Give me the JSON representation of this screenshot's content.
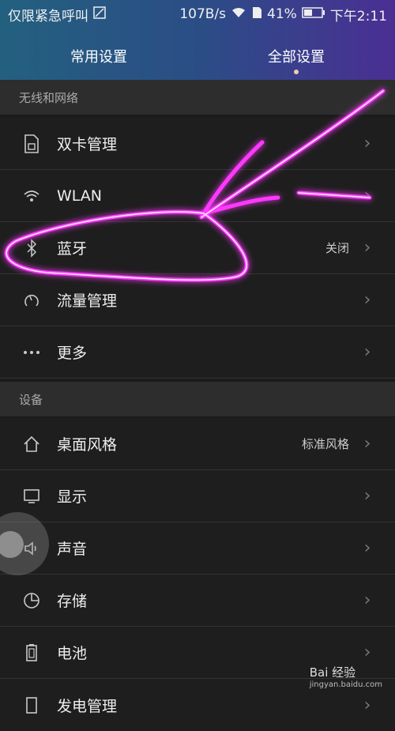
{
  "status_bar": {
    "left_text": "仅限紧急呼叫",
    "speed": "107B/s",
    "battery": "41%",
    "time": "下午2:11"
  },
  "tabs": [
    {
      "label": "常用设置",
      "active": false
    },
    {
      "label": "全部设置",
      "active": true
    }
  ],
  "sections": [
    {
      "title": "无线和网络"
    },
    {
      "title": "设备"
    }
  ],
  "rows": [
    {
      "label": "双卡管理",
      "value": "",
      "icon": "sim-card-icon"
    },
    {
      "label": "WLAN",
      "value": "",
      "icon": "wifi-icon"
    },
    {
      "label": "蓝牙",
      "value": "关闭",
      "icon": "bluetooth-icon"
    },
    {
      "label": "流量管理",
      "value": "",
      "icon": "data-usage-icon"
    },
    {
      "label": "更多",
      "value": "",
      "icon": "more-icon"
    },
    {
      "label": "桌面风格",
      "value": "标准风格",
      "icon": "home-icon"
    },
    {
      "label": "显示",
      "value": "",
      "icon": "display-icon"
    },
    {
      "label": "声音",
      "value": "",
      "icon": "sound-icon"
    },
    {
      "label": "存储",
      "value": "",
      "icon": "storage-icon"
    },
    {
      "label": "电池",
      "value": "",
      "icon": "battery-icon"
    },
    {
      "label": "发电管理",
      "value": "",
      "icon": "power-icon"
    }
  ],
  "watermark": {
    "brand": "Bai 经验",
    "url": "jingyan.baidu.com"
  },
  "colors": {
    "accent_dot": "#f4c9b2",
    "annotation": "#ff37ff"
  }
}
